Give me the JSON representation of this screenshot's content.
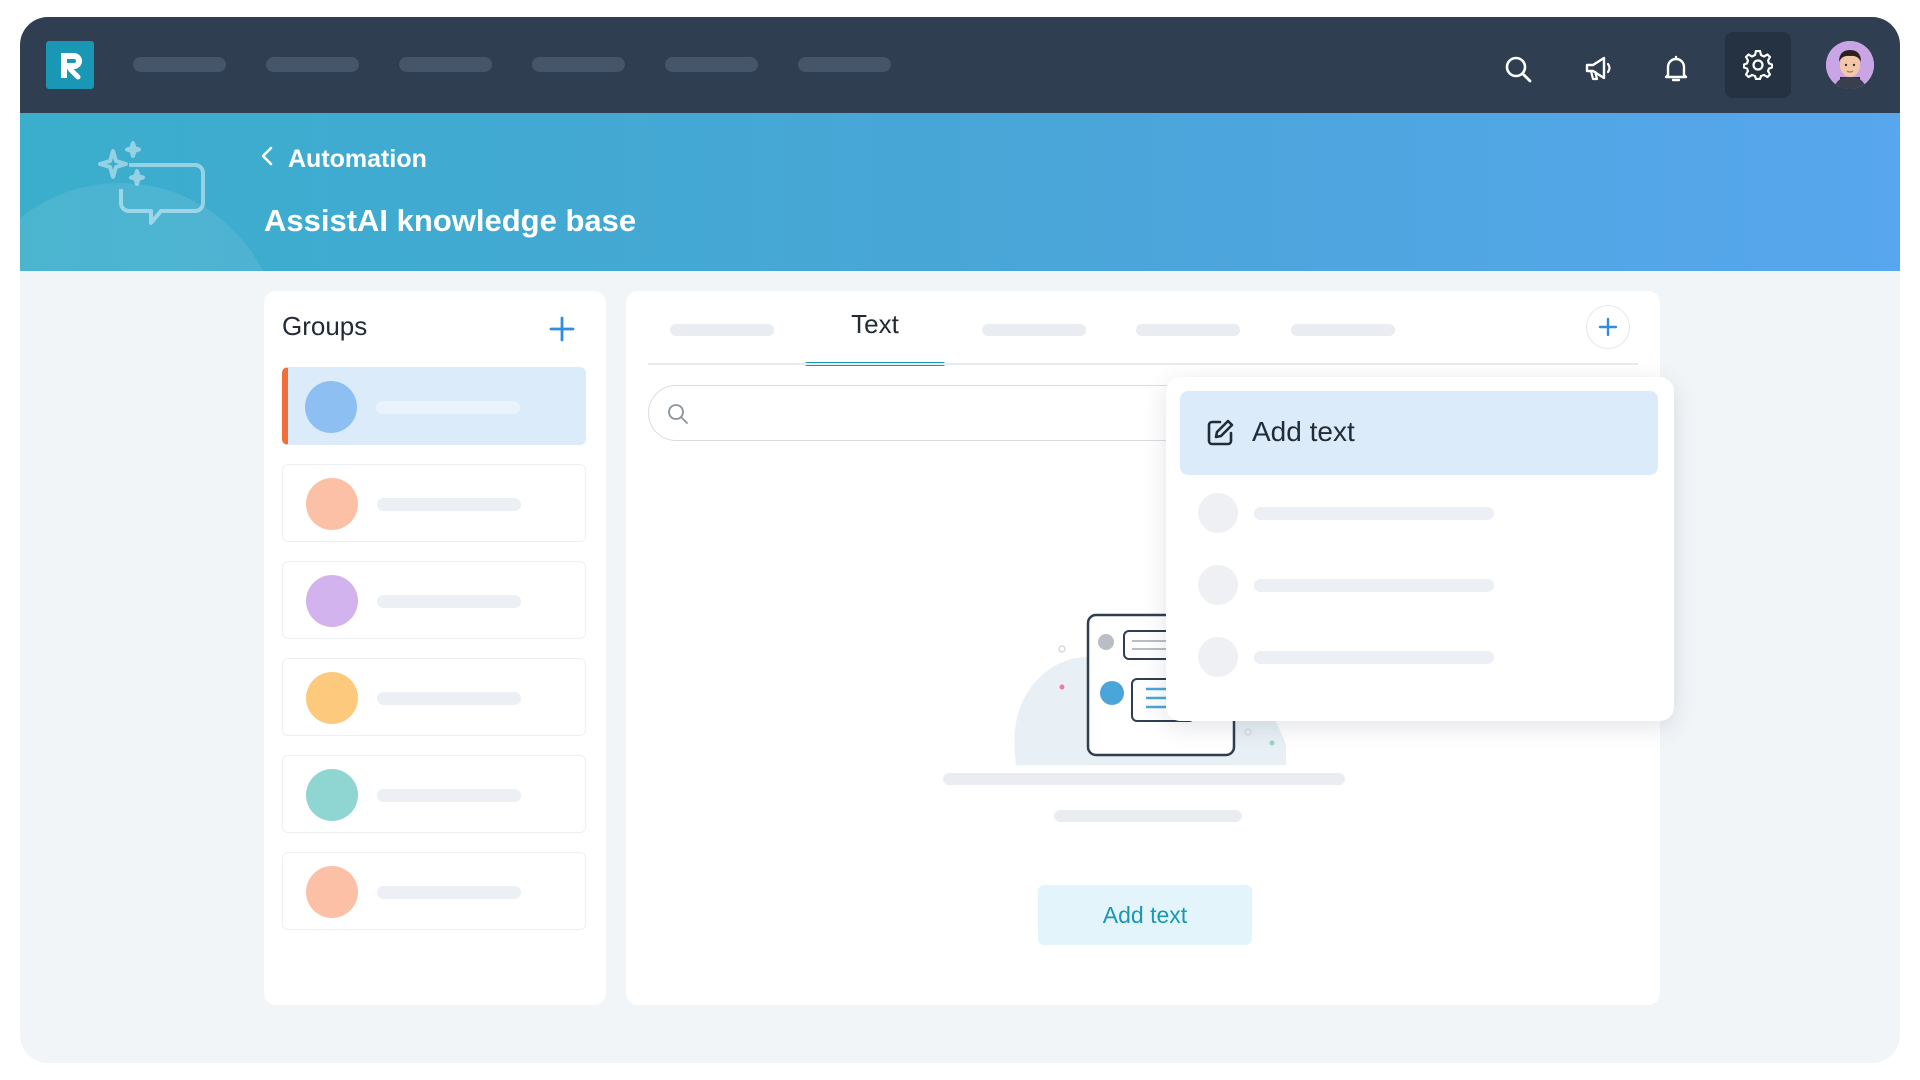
{
  "topnav": {
    "logo_icon": "brand-logo",
    "nav_items": [
      "",
      "",
      "",
      "",
      "",
      ""
    ],
    "icons": [
      "search-icon",
      "megaphone-icon",
      "bell-icon",
      "gear-icon"
    ]
  },
  "banner": {
    "breadcrumb_label": "Automation",
    "page_title": "AssistAI knowledge base",
    "decor_icon": "ai-chat-icon"
  },
  "groups": {
    "title": "Groups",
    "items": [
      {
        "color": "#8dbff2",
        "selected": true
      },
      {
        "color": "#fcc0a6",
        "selected": false
      },
      {
        "color": "#d2b3ee",
        "selected": false
      },
      {
        "color": "#fdc97c",
        "selected": false
      },
      {
        "color": "#8fd6d3",
        "selected": false
      },
      {
        "color": "#fcc0a6",
        "selected": false
      }
    ]
  },
  "main": {
    "active_tab": "Text",
    "search_placeholder": "",
    "empty_state_button": "Add text"
  },
  "dropdown": {
    "active_item_label": "Add text"
  },
  "colors": {
    "accent": "#1a97b4",
    "nav_bg": "#2f3e50",
    "selected_marker": "#ef6e3a"
  }
}
